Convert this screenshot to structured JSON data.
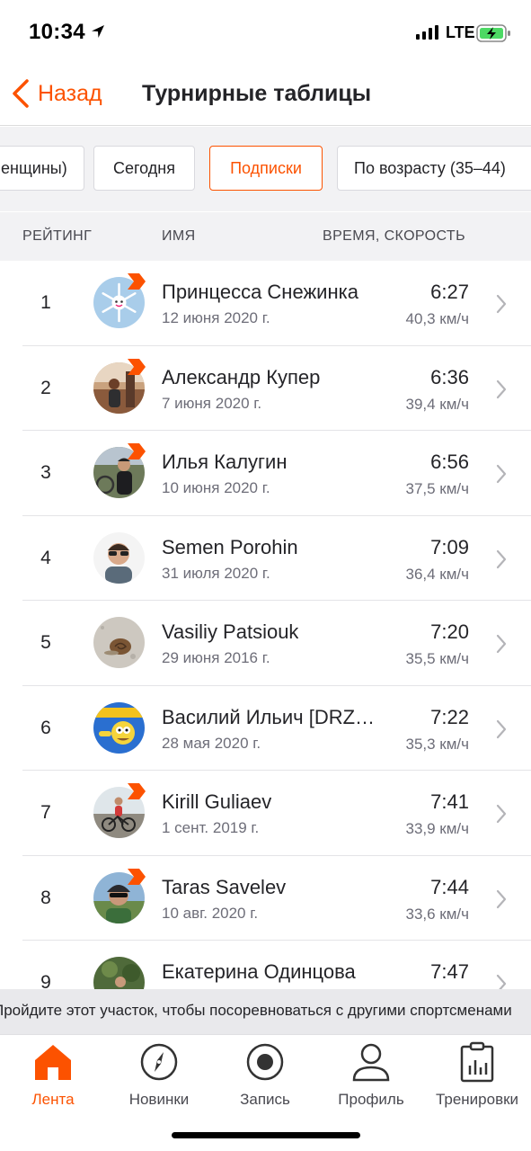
{
  "status_bar": {
    "time": "10:34",
    "network": "LTE"
  },
  "nav": {
    "back_label": "Назад",
    "title": "Турнирные таблицы"
  },
  "filters": [
    {
      "label": "енщины)",
      "active": false
    },
    {
      "label": "Сегодня",
      "active": false
    },
    {
      "label": "Подписки",
      "active": true
    },
    {
      "label": "По возрасту (35–44)",
      "active": false
    }
  ],
  "table_header": {
    "rank": "РЕЙТИНГ",
    "name": "ИМЯ",
    "time_speed": "ВРЕМЯ, СКОРОСТЬ"
  },
  "rows": [
    {
      "rank": "1",
      "name": "Принцесса Снежинка",
      "date": "12 июня 2020 г.",
      "time": "6:27",
      "speed": "40,3 км/ч",
      "avatar": "snowflake-avatar",
      "badge": true
    },
    {
      "rank": "2",
      "name": "Александр Купер",
      "date": "7 июня 2020 г.",
      "time": "6:36",
      "speed": "39,4 км/ч",
      "avatar": "photo-avatar",
      "badge": true
    },
    {
      "rank": "3",
      "name": "Илья Калугин",
      "date": "10 июня 2020 г.",
      "time": "6:56",
      "speed": "37,5 км/ч",
      "avatar": "photo-avatar",
      "badge": true
    },
    {
      "rank": "4",
      "name": "Semen Porohin",
      "date": "31 июля 2020 г.",
      "time": "7:09",
      "speed": "36,4 км/ч",
      "avatar": "photo-avatar",
      "badge": false
    },
    {
      "rank": "5",
      "name": "Vasiliy Patsiouk",
      "date": "29 июня 2016 г.",
      "time": "7:20",
      "speed": "35,5 км/ч",
      "avatar": "snail-avatar",
      "badge": false
    },
    {
      "rank": "6",
      "name": "Василий Ильич [DRZ…",
      "date": "28 мая 2020 г.",
      "time": "7:22",
      "speed": "35,3 км/ч",
      "avatar": "cartoon-avatar",
      "badge": false
    },
    {
      "rank": "7",
      "name": "Kirill Guliaev",
      "date": "1 сент. 2019 г.",
      "time": "7:41",
      "speed": "33,9 км/ч",
      "avatar": "cyclist-avatar",
      "badge": true
    },
    {
      "rank": "8",
      "name": "Taras Savelev",
      "date": "10 авг. 2020 г.",
      "time": "7:44",
      "speed": "33,6 км/ч",
      "avatar": "helmet-avatar",
      "badge": true
    },
    {
      "rank": "9",
      "name": "Екатерина Одинцова",
      "date": "",
      "time": "7:47",
      "speed": "",
      "avatar": "photo-avatar",
      "badge": false
    }
  ],
  "banner": {
    "text": "Пройдите этот участок, чтобы посоревноваться с другими спортсменами"
  },
  "tabs": [
    {
      "label": "Лента",
      "icon": "home-icon",
      "active": true
    },
    {
      "label": "Новинки",
      "icon": "compass-icon",
      "active": false
    },
    {
      "label": "Запись",
      "icon": "record-icon",
      "active": false
    },
    {
      "label": "Профиль",
      "icon": "profile-icon",
      "active": false
    },
    {
      "label": "Тренировки",
      "icon": "training-log-icon",
      "active": false
    }
  ],
  "colors": {
    "accent": "#fc5200",
    "text": "#242428",
    "secondary_text": "#6d6d78",
    "header_bg": "#f2f2f4"
  }
}
